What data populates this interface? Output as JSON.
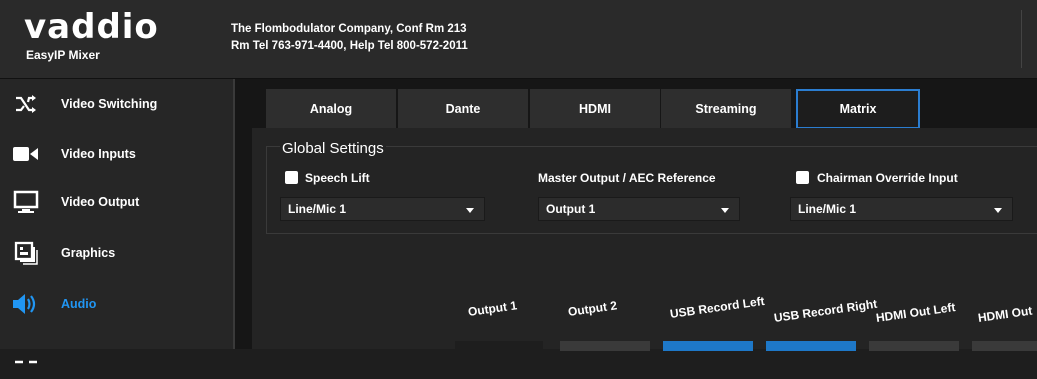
{
  "brand": {
    "logo_text": "vaddio",
    "product": "EasyIP Mixer"
  },
  "header": {
    "line1": "The Flombodulator Company, Conf Rm 213",
    "line2": "Rm Tel 763-971-4400, Help Tel 800-572-2011"
  },
  "sidebar": {
    "items": [
      {
        "label": "Video Switching",
        "icon": "shuffle-icon"
      },
      {
        "label": "Video Inputs",
        "icon": "video-camera-icon"
      },
      {
        "label": "Video Output",
        "icon": "monitor-icon"
      },
      {
        "label": "Graphics",
        "icon": "graphics-icon"
      },
      {
        "label": "Audio",
        "icon": "speaker-icon",
        "active": true
      }
    ]
  },
  "tabs": [
    {
      "label": "Analog"
    },
    {
      "label": "Dante"
    },
    {
      "label": "HDMI"
    },
    {
      "label": "Streaming"
    },
    {
      "label": "Matrix",
      "active": true
    }
  ],
  "global_settings": {
    "title": "Global Settings",
    "speech_lift_label": "Speech Lift",
    "speech_lift_select": "Line/Mic 1",
    "master_output_label": "Master Output / AEC Reference",
    "master_output_select": "Output 1",
    "chairman_label": "Chairman Override Input",
    "chairman_select": "Line/Mic 1"
  },
  "matrix": {
    "columns": [
      "Output 1",
      "Output 2",
      "USB Record Left",
      "USB Record Right",
      "HDMI Out Left",
      "HDMI Out"
    ]
  },
  "colors": {
    "accent": "#2196f3",
    "active_tab_border": "#2b7dd0",
    "cell_blue": "#1e78c8",
    "cell_gray": "#3a3a3a"
  }
}
